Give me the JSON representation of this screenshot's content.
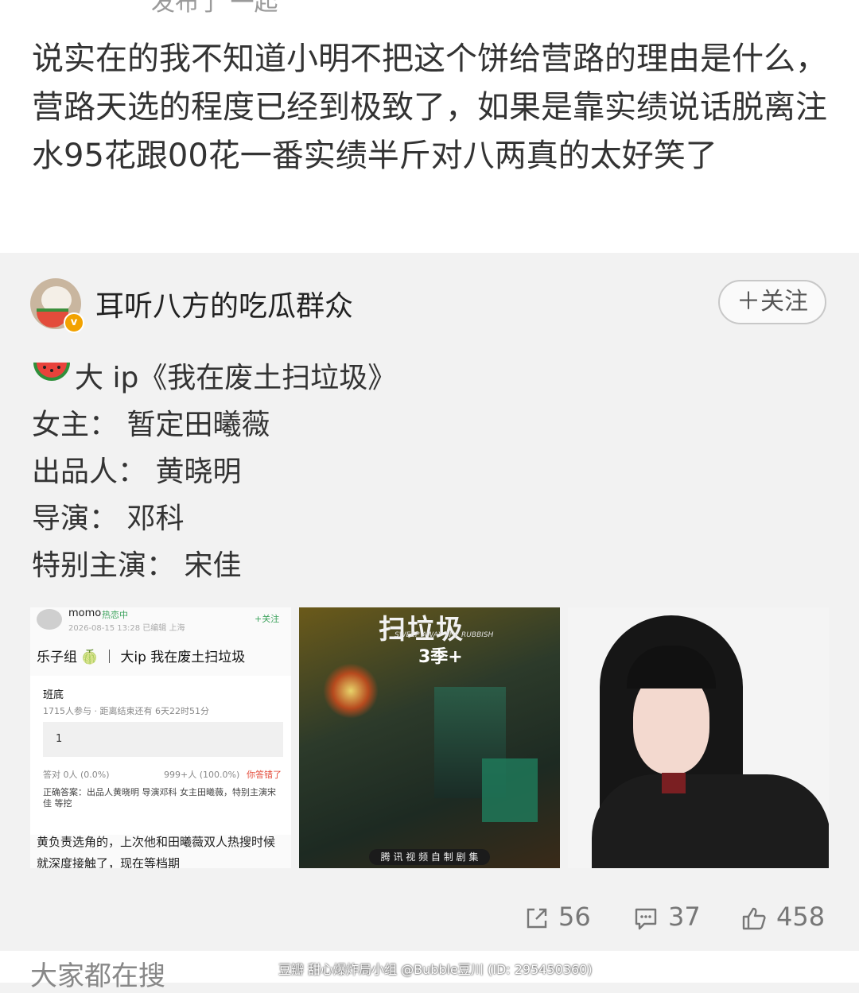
{
  "header": {
    "cut_text": "发布了 一起"
  },
  "post": {
    "text": "说实在的我不知道小明不把这个饼给营路的理由是什么，营路天选的程度已经到极致了，如果是靠实绩说话脱离注水95花跟00花一番实绩半斤对八两真的太好笑了"
  },
  "repost": {
    "author": "耳听八方的吃瓜群众",
    "follow_label": "＋关注",
    "lines": [
      "大 ip《我在废土扫垃圾》",
      "女主：  暂定田曦薇",
      "出品人：  黄晓明",
      "导演：  邓科",
      "特别主演：  宋佳"
    ],
    "images": [
      {
        "user": "momo",
        "tag": "热恋中",
        "date": "2026-08-15 13:28  已编辑  上海",
        "follow": "+关注",
        "title": "乐子组 🍈 ｜ 大ip 我在废土扫垃圾",
        "poll_title": "班底",
        "poll_meta": "1715人参与 · 距离结束还有 6天22时51分",
        "option": "1",
        "res_left": "答对  0人  (0.0%)",
        "res_mid": "999+人  (100.0%)",
        "res_right": "你答错了",
        "answer": "正确答案：出品人黄晓明 导演邓科 女主田曦薇，特别主演宋佳 等挖",
        "comment": "黄负责选角的，上次他和田曦薇双人热搜时候就深度接触了，现在等档期"
      },
      {
        "poster_title": "扫垃圾",
        "poster_en": "SWEEP AWAY THE RUBBISH",
        "season": "3季+",
        "banner": "腾 讯 视 频 自 制 剧 集"
      },
      {}
    ],
    "stats": {
      "share": "56",
      "comment": "37",
      "like": "458"
    }
  },
  "footer": {
    "search_label": "大家都在搜",
    "watermark": "豆瓣   甜心爆炸局小组 @Bubble豆川 (ID: 295450360)"
  },
  "colors": {
    "badge": "#f2a200",
    "follow_border": "#c8c8c8",
    "red_hint": "#e34c3b",
    "green_tag": "#3da35d"
  }
}
